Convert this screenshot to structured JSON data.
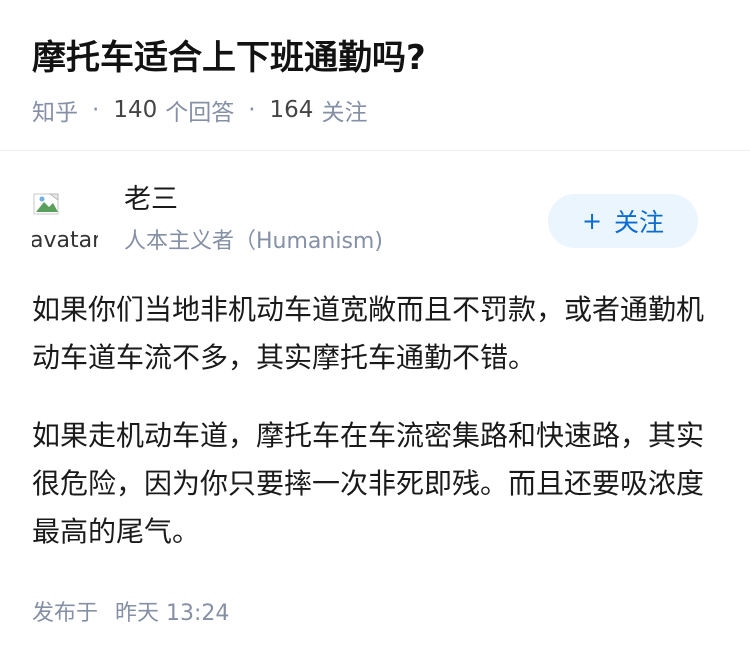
{
  "question": {
    "title": "摩托车适合上下班通勤吗?",
    "source": "知乎",
    "answer_count": "140",
    "answer_label": "个回答",
    "follower_count": "164",
    "follower_label": "关注",
    "separator": "·"
  },
  "author": {
    "name": "老三",
    "headline": "人本主义者（Humanism)",
    "avatar_alt": "avatar",
    "follow_plus": "+",
    "follow_label": "关注"
  },
  "answer": {
    "paragraphs": [
      "如果你们当地非机动车道宽敞而且不罚款，或者通勤机动车道车流不多，其实摩托车通勤不错。",
      "如果走机动车道，摩托车在车流密集路和快速路，其实很危险，因为你只要摔一次非死即残。而且还要吸浓度最高的尾气。"
    ],
    "published_prefix": "发布于",
    "published_time": "昨天 13:24"
  },
  "colors": {
    "accent": "#0c6bd0",
    "follow_bg": "#ebf5fd",
    "meta_gray": "#8590a6"
  }
}
